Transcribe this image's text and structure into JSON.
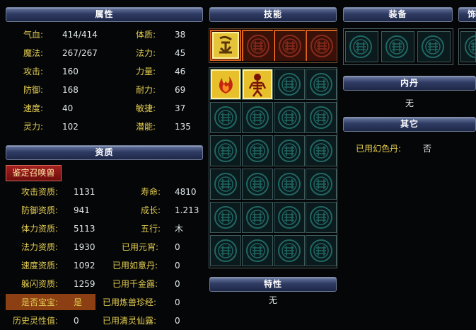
{
  "attributes": {
    "header": "属性",
    "rows": [
      {
        "l1": "气血:",
        "v1": "414/414",
        "l2": "体质:",
        "v2": "38"
      },
      {
        "l1": "魔法:",
        "v1": "267/267",
        "l2": "法力:",
        "v2": "45"
      },
      {
        "l1": "攻击:",
        "v1": "160",
        "l2": "力量:",
        "v2": "46"
      },
      {
        "l1": "防御:",
        "v1": "168",
        "l2": "耐力:",
        "v2": "69"
      },
      {
        "l1": "速度:",
        "v1": "40",
        "l2": "敏捷:",
        "v2": "37"
      },
      {
        "l1": "灵力:",
        "v1": "102",
        "l2": "潜能:",
        "v2": "135"
      }
    ]
  },
  "aptitude": {
    "header": "资质",
    "identify_button": "鉴定召唤兽",
    "rows": [
      {
        "l1": "攻击资质:",
        "v1": "1131",
        "l2": "寿命:",
        "v2": "4810"
      },
      {
        "l1": "防御资质:",
        "v1": "941",
        "l2": "成长:",
        "v2": "1.213"
      },
      {
        "l1": "体力资质:",
        "v1": "5113",
        "l2": "五行:",
        "v2": "木"
      },
      {
        "l1": "法力资质:",
        "v1": "1930",
        "l2": "已用元宵:",
        "v2": "0"
      },
      {
        "l1": "速度资质:",
        "v1": "1092",
        "l2": "已用如意丹:",
        "v2": "0"
      },
      {
        "l1": "躲闪资质:",
        "v1": "1259",
        "l2": "已用千金露:",
        "v2": "0"
      },
      {
        "l1": "是否宝宝:",
        "v1": "是",
        "l2": "已用炼兽珍经:",
        "v2": "0"
      },
      {
        "l1": "历史灵性值:",
        "v1": "0",
        "l2": "已用清灵仙露:",
        "v2": "0"
      }
    ]
  },
  "skills": {
    "header": "技能",
    "top_row": [
      "yellow-rune-skill-icon",
      "locked-slot-icon",
      "locked-slot-icon",
      "locked-slot-icon"
    ],
    "grid_filled": [
      "flame-skill-icon",
      "skeleton-skill-icon"
    ]
  },
  "trait": {
    "header": "特性",
    "value": "无"
  },
  "equipment": {
    "header": "装备",
    "decor_header": "饰"
  },
  "inner_core": {
    "header": "内丹",
    "value": "无"
  },
  "other": {
    "header": "其它",
    "label": "已用幻色丹:",
    "value": "否"
  },
  "colors": {
    "label": "#e3cd52",
    "value": "#dfe6ea",
    "header_bg": "#2f3b63",
    "accent_orange": "#d8611e"
  }
}
